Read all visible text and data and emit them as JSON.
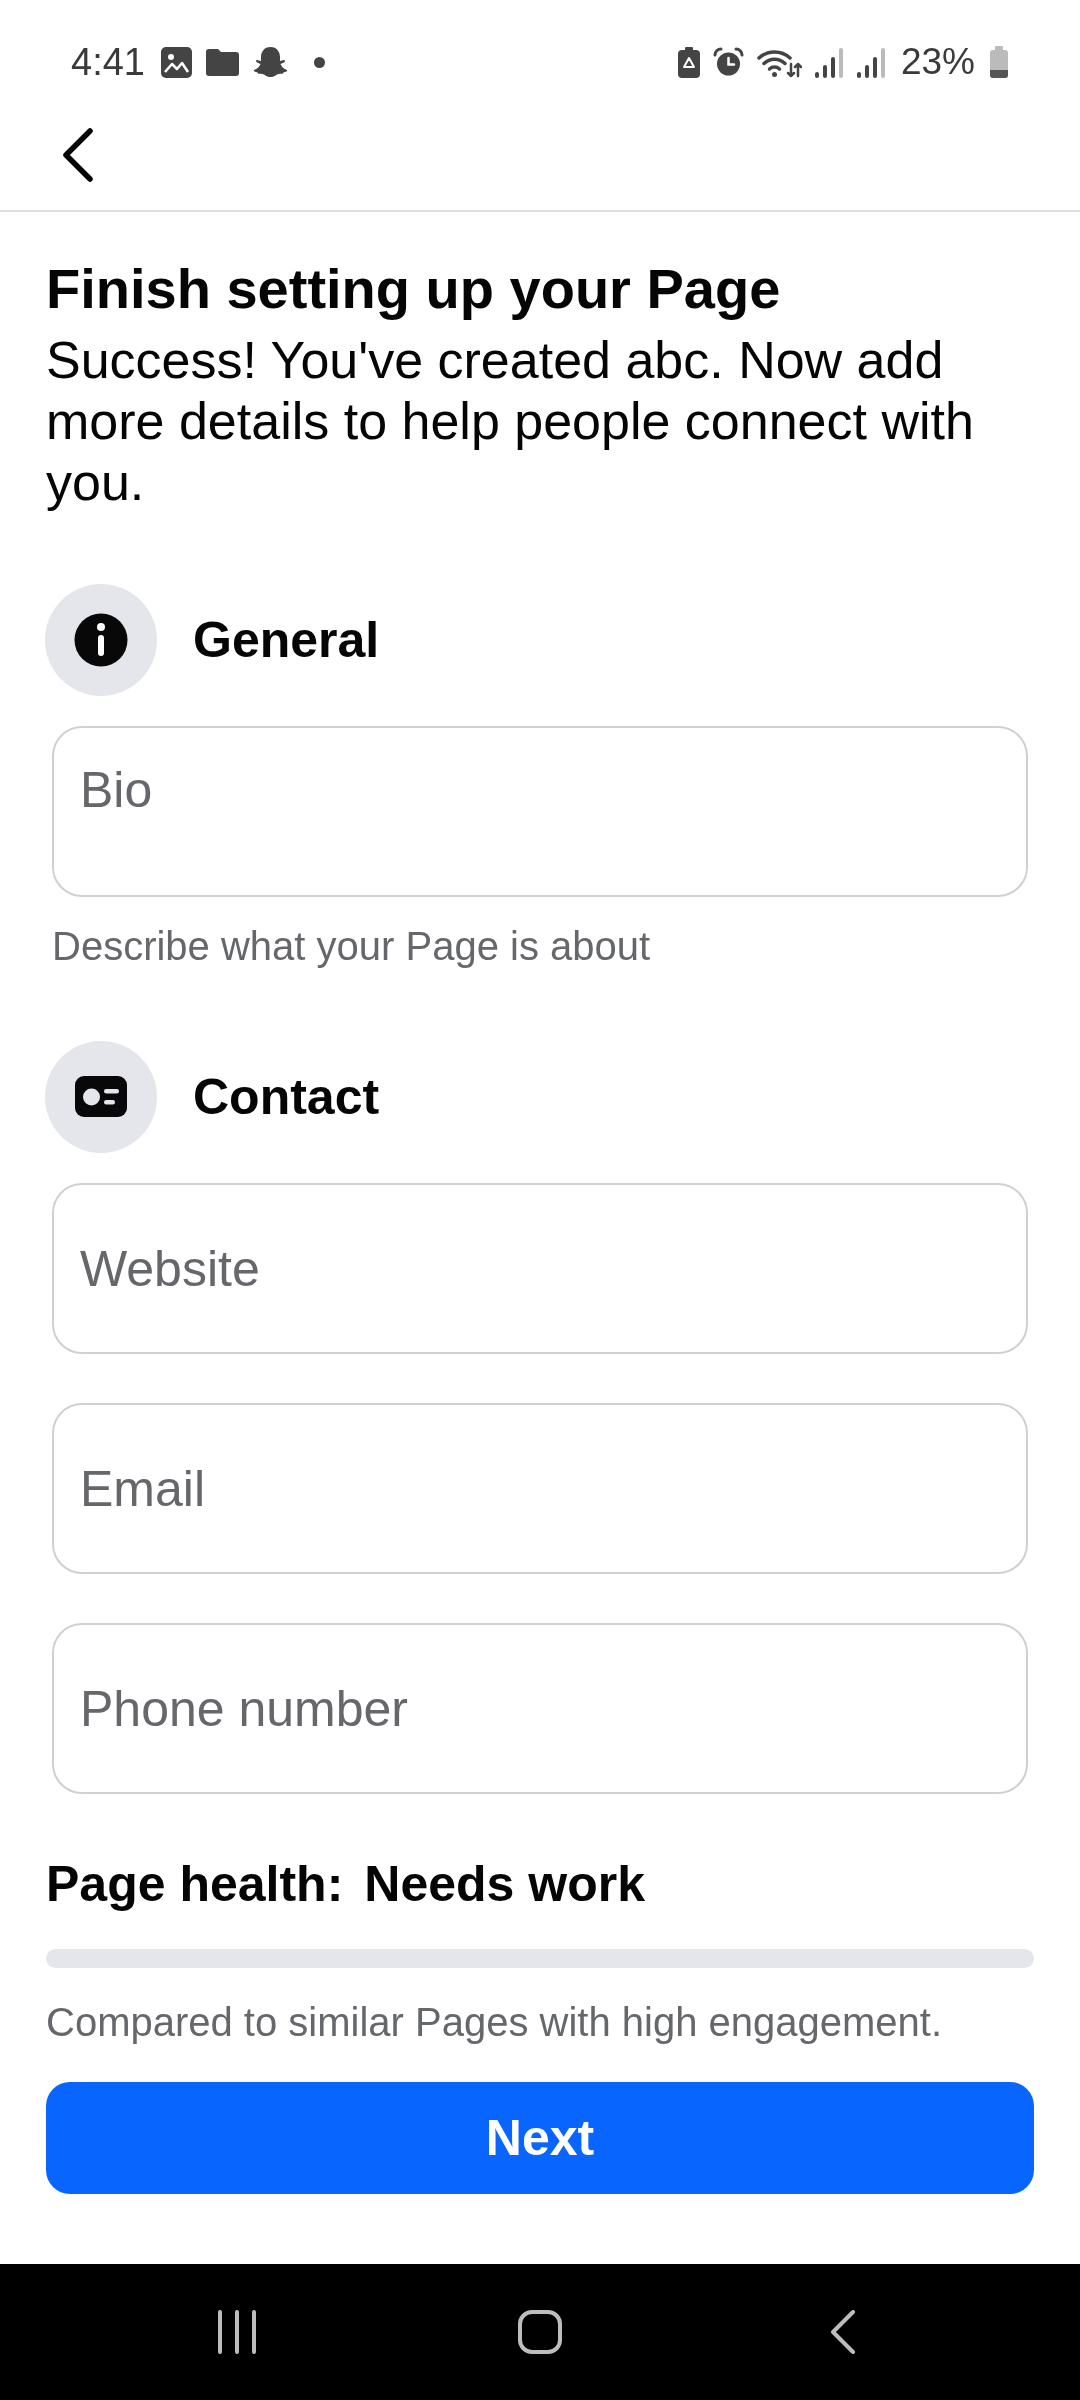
{
  "status_bar": {
    "time": "4:41",
    "battery_percent": "23%"
  },
  "intro": {
    "title": "Finish setting up your Page",
    "subtitle": "Success! You've created abc. Now add more details to help people connect with you."
  },
  "sections": [
    {
      "kind": "general",
      "title": "General",
      "fields": [
        {
          "kind": "multiline",
          "placeholder": "Bio"
        }
      ],
      "helper": "Describe what your Page is about"
    },
    {
      "kind": "contact",
      "title": "Contact",
      "fields": [
        {
          "kind": "text",
          "placeholder": "Website"
        },
        {
          "kind": "text",
          "placeholder": "Email"
        },
        {
          "kind": "text",
          "placeholder": "Phone number"
        }
      ]
    }
  ],
  "page_health": {
    "label": "Page health:",
    "value": "Needs work",
    "level": 0,
    "caption": "Compared to similar Pages with high engagement."
  },
  "next_button": {
    "label": "Next"
  }
}
